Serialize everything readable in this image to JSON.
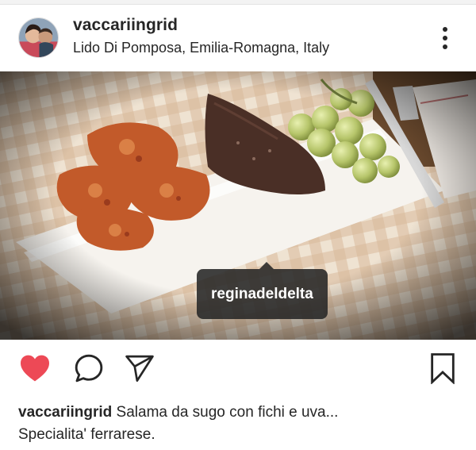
{
  "post": {
    "username": "vaccariingrid",
    "location": "Lido Di Pomposa, Emilia-Romagna, Italy"
  },
  "photo": {
    "tag_label": "reginadeldelta"
  },
  "caption": {
    "username": "vaccariingrid",
    "text_line1": " Salama da sugo con fichi e uva...",
    "text_line2": "Specialita' ferrarese."
  },
  "icons": {
    "more": "more-vertical-icon",
    "like": "heart-filled-icon",
    "comment": "comment-bubble-icon",
    "share": "paper-plane-icon",
    "save": "bookmark-icon",
    "user_tags": "person-icon"
  },
  "colors": {
    "like_red": "#ed4956",
    "text": "#262626",
    "tooltip_bg": "#262626"
  }
}
